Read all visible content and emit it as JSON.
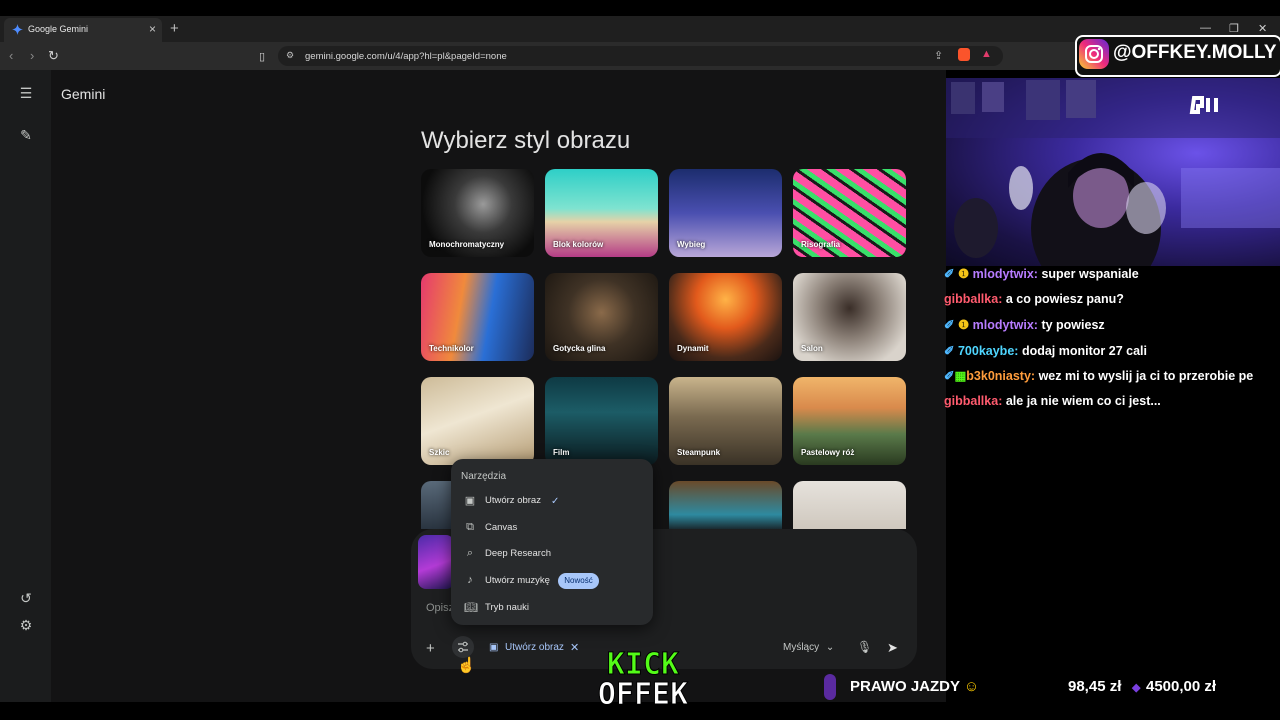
{
  "browser": {
    "tab_title": "Google Gemini",
    "url": "gemini.google.com/u/4/app?hl=pl&pageId=none"
  },
  "app": {
    "brand": "Gemini",
    "heading": "Wybierz styl obrazu",
    "styles": [
      {
        "label": "Monochromatyczny"
      },
      {
        "label": "Blok kolorów"
      },
      {
        "label": "Wybieg"
      },
      {
        "label": "Risografia"
      },
      {
        "label": "Technikolor"
      },
      {
        "label": "Gotycka glina"
      },
      {
        "label": "Dynamit"
      },
      {
        "label": "Salon"
      },
      {
        "label": "Szkic"
      },
      {
        "label": "Film"
      },
      {
        "label": "Steampunk"
      },
      {
        "label": "Pastelowy róż"
      }
    ],
    "composer": {
      "placeholder": "Opisz",
      "active_tool": "Utwórz obraz",
      "model": "Myślący"
    },
    "tools_menu": {
      "title": "Narzędzia",
      "items": [
        {
          "label": "Utwórz obraz",
          "icon": "image-icon",
          "selected": true
        },
        {
          "label": "Canvas",
          "icon": "canvas-icon"
        },
        {
          "label": "Deep Research",
          "icon": "research-icon"
        },
        {
          "label": "Utwórz muzykę",
          "icon": "music-icon",
          "badge": "Nowość"
        },
        {
          "label": "Tryb nauki",
          "icon": "book-icon"
        }
      ]
    }
  },
  "overlay": {
    "instagram_handle": "@OFFKEY.MOLLY",
    "chat": [
      {
        "user": "mlodytwix",
        "text": "super wspaniale",
        "color": "#b77cff"
      },
      {
        "user": "gibballka",
        "text": "a co powiesz panu?",
        "color": "#ff5b6e"
      },
      {
        "user": "mlodytwix",
        "text": "ty powiesz",
        "color": "#b77cff"
      },
      {
        "user": "700kaybe",
        "text": "dodaj monitor 27 cali",
        "color": "#4fd6ff"
      },
      {
        "user": "b3k0niasty",
        "text": "wez mi to wyslij ja ci to przerobie pe",
        "color": "#ff9d3c"
      },
      {
        "user": "gibballka",
        "text": "ale ja nie wiem co ci jest...",
        "color": "#ff5b6e"
      }
    ],
    "ticker_title": "PRAWO JAZDY",
    "ticker_amount": "98,45 zł",
    "ticker_goal": "4500,00 zł",
    "logo_top": "KICK",
    "logo_bottom": "OFFEK"
  }
}
